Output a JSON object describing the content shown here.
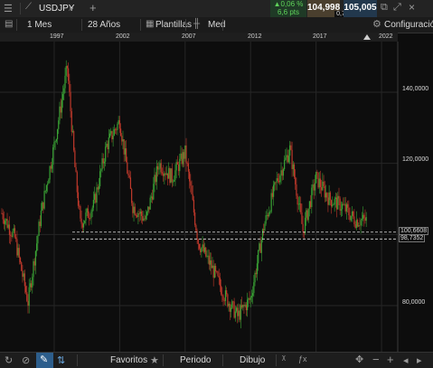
{
  "header": {
    "symbol": "USDJPY",
    "add_label": "+",
    "change_percent": "0,06 %",
    "change_pips": "6,6 pts",
    "sell_price": "104,998",
    "spread": "0,7",
    "buy_price": "105,005",
    "settings_label": "Configuración"
  },
  "toolbar": {
    "interval": "1 Mes",
    "range": "28 Años",
    "templates": "Plantillas",
    "price_type": "Med"
  },
  "chart_data": {
    "type": "candlestick",
    "x_ticks": [
      "1997",
      "2002",
      "2007",
      "2012",
      "2017",
      "2022"
    ],
    "y_ticks": [
      "140,0000",
      "120,0000",
      "80,0000"
    ],
    "ylim": [
      70,
      155
    ],
    "price_lines": [
      "100,6608",
      "98,7352"
    ],
    "colors": {
      "up": "#3aa335",
      "down": "#c0392b",
      "background": "#0d0d0d"
    },
    "close_series": [
      {
        "year": 1993,
        "value": 106
      },
      {
        "year": 1994,
        "value": 99
      },
      {
        "year": 1995,
        "value": 81
      },
      {
        "year": 1996,
        "value": 106
      },
      {
        "year": 1997,
        "value": 125
      },
      {
        "year": 1998,
        "value": 147
      },
      {
        "year": 1998.6,
        "value": 118
      },
      {
        "year": 1999,
        "value": 103
      },
      {
        "year": 2000,
        "value": 108
      },
      {
        "year": 2001,
        "value": 125
      },
      {
        "year": 2002,
        "value": 132
      },
      {
        "year": 2003,
        "value": 108
      },
      {
        "year": 2004,
        "value": 104
      },
      {
        "year": 2005,
        "value": 120
      },
      {
        "year": 2006,
        "value": 116
      },
      {
        "year": 2007,
        "value": 123
      },
      {
        "year": 2008,
        "value": 98
      },
      {
        "year": 2009,
        "value": 91
      },
      {
        "year": 2010,
        "value": 83
      },
      {
        "year": 2011,
        "value": 77
      },
      {
        "year": 2012,
        "value": 82
      },
      {
        "year": 2013,
        "value": 102
      },
      {
        "year": 2014,
        "value": 115
      },
      {
        "year": 2015,
        "value": 124
      },
      {
        "year": 2016,
        "value": 101
      },
      {
        "year": 2017,
        "value": 116
      },
      {
        "year": 2018,
        "value": 110
      },
      {
        "year": 2019,
        "value": 108
      },
      {
        "year": 2020,
        "value": 104
      }
    ]
  },
  "bottom": {
    "favorites": "Favoritos",
    "period": "Periodo",
    "drawing": "Dibujo"
  }
}
